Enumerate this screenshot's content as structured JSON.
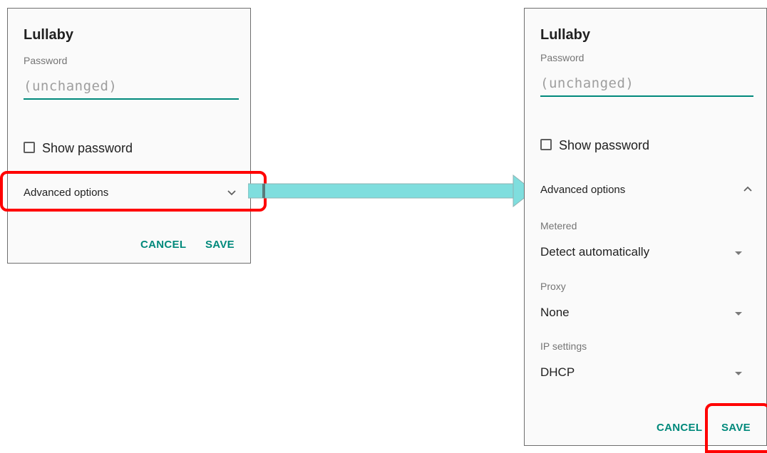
{
  "left_dialog": {
    "title": "Lullaby",
    "password_label": "Password",
    "password_value": "(unchanged)",
    "show_password_label": "Show password",
    "show_password_checked": false,
    "advanced_label": "Advanced options",
    "advanced_expanded": false,
    "cancel_label": "CANCEL",
    "save_label": "SAVE"
  },
  "right_dialog": {
    "title": "Lullaby",
    "password_label": "Password",
    "password_value": "(unchanged)",
    "show_password_label": "Show password",
    "show_password_checked": false,
    "advanced_label": "Advanced options",
    "advanced_expanded": true,
    "metered_label": "Metered",
    "metered_value": "Detect automatically",
    "proxy_label": "Proxy",
    "proxy_value": "None",
    "ip_label": "IP settings",
    "ip_value": "DHCP",
    "cancel_label": "CANCEL",
    "save_label": "SAVE"
  },
  "colors": {
    "accent": "#00897b",
    "highlight": "#ff0000",
    "arrow": "#7fdede"
  },
  "icons": {
    "collapsed": "chevron-down-icon",
    "expanded": "chevron-up-icon",
    "dropdown": "caret-down-icon",
    "flow": "arrow-right-icon"
  }
}
